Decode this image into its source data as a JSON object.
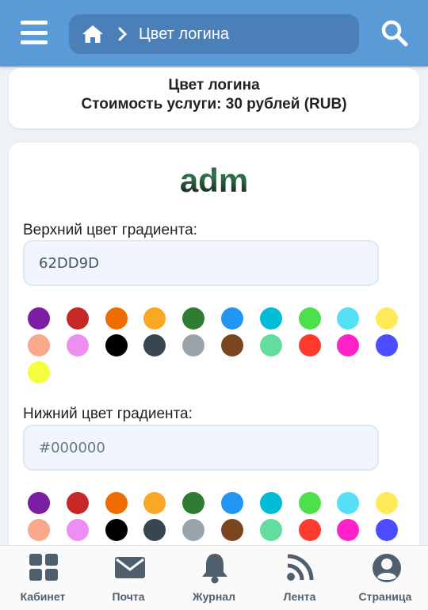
{
  "header": {
    "breadcrumb_label": "Цвет логина"
  },
  "info": {
    "title": "Цвет логина",
    "price": "Стоимость услуги: 30 рублей (RUB)"
  },
  "preview": {
    "username": "adm"
  },
  "top_gradient": {
    "label": "Верхний цвет градиента:",
    "value": "62DD9D"
  },
  "bottom_gradient": {
    "label": "Нижний цвет градиента:",
    "placeholder": "#000000"
  },
  "palette_top": [
    "#7b1fa2",
    "#c62828",
    "#ef6c00",
    "#f9a825",
    "#2e7d32",
    "#2196f3",
    "#00bcd4",
    "#4ce04c",
    "#55e0f5",
    "#ffeb5a",
    "#f8a98c",
    "#ee8ef0",
    "#000000",
    "#37474f",
    "#9aa4ad",
    "#7b4520",
    "#62dd9d",
    "#ff3b30",
    "#ff22c8",
    "#4d4dff",
    "#f6ff3d"
  ],
  "palette_bottom": [
    "#7b1fa2",
    "#c62828",
    "#ef6c00",
    "#f9a825",
    "#2e7d32",
    "#2196f3",
    "#00bcd4",
    "#4ce04c",
    "#55e0f5",
    "#ffeb5a",
    "#f8a98c",
    "#ee8ef0",
    "#000000",
    "#37474f",
    "#9aa4ad",
    "#7b4520",
    "#62dd9d",
    "#ff3b30",
    "#ff22c8",
    "#4d4dff"
  ],
  "nav": {
    "items": [
      {
        "label": "Кабинет",
        "icon": "grid-icon"
      },
      {
        "label": "Почта",
        "icon": "mail-icon"
      },
      {
        "label": "Журнал",
        "icon": "bell-icon"
      },
      {
        "label": "Лента",
        "icon": "rss-icon"
      },
      {
        "label": "Страница",
        "icon": "user-icon"
      }
    ]
  },
  "colors": {
    "header_bg": "#5a9ad6",
    "icon_gray": "#4f5f6e"
  }
}
